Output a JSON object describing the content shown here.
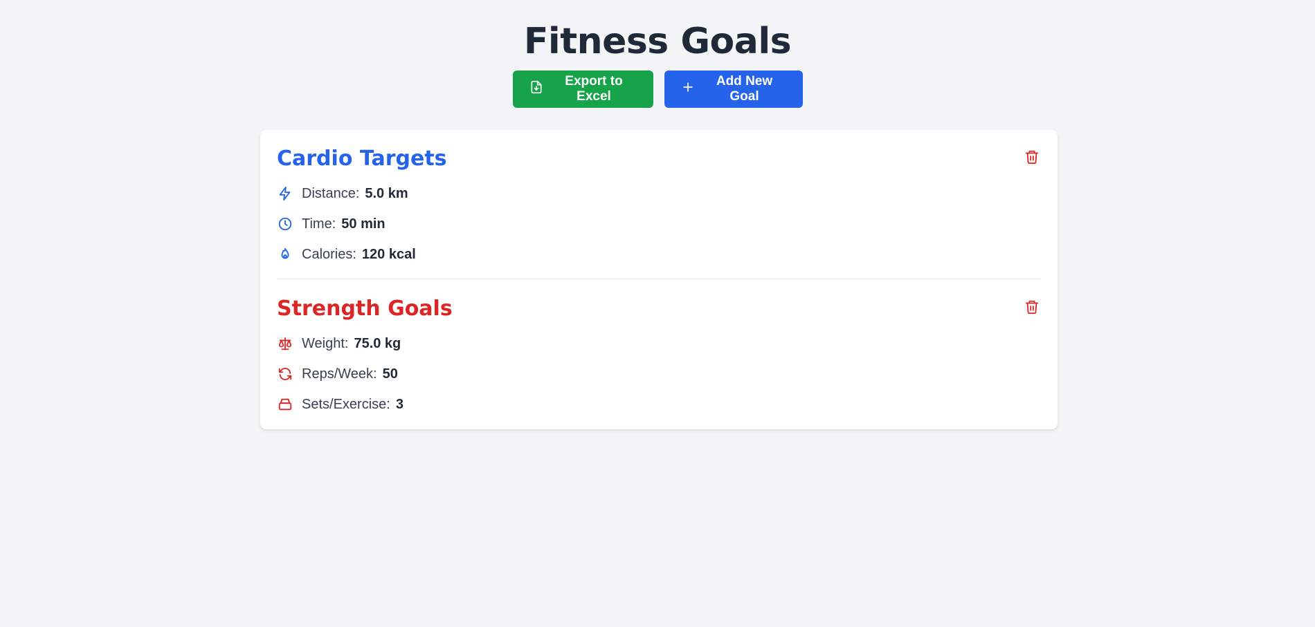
{
  "header": {
    "title": "Fitness Goals",
    "export_label": "Export to Excel",
    "add_label": "Add New Goal"
  },
  "colors": {
    "export_button": "#16a34a",
    "add_button": "#2563eb",
    "cardio_accent": "#2563eb",
    "strength_accent": "#dc2626"
  },
  "sections": [
    {
      "title": "Cardio Targets",
      "items": [
        {
          "icon": "lightning-icon",
          "label": "Distance:",
          "value": "5.0 km"
        },
        {
          "icon": "clock-icon",
          "label": "Time:",
          "value": "50 min"
        },
        {
          "icon": "flame-icon",
          "label": "Calories:",
          "value": "120 kcal"
        }
      ]
    },
    {
      "title": "Strength Goals",
      "items": [
        {
          "icon": "scale-icon",
          "label": "Weight:",
          "value": "75.0 kg"
        },
        {
          "icon": "refresh-icon",
          "label": "Reps/Week:",
          "value": "50"
        },
        {
          "icon": "stack-icon",
          "label": "Sets/Exercise:",
          "value": "3"
        }
      ]
    }
  ]
}
